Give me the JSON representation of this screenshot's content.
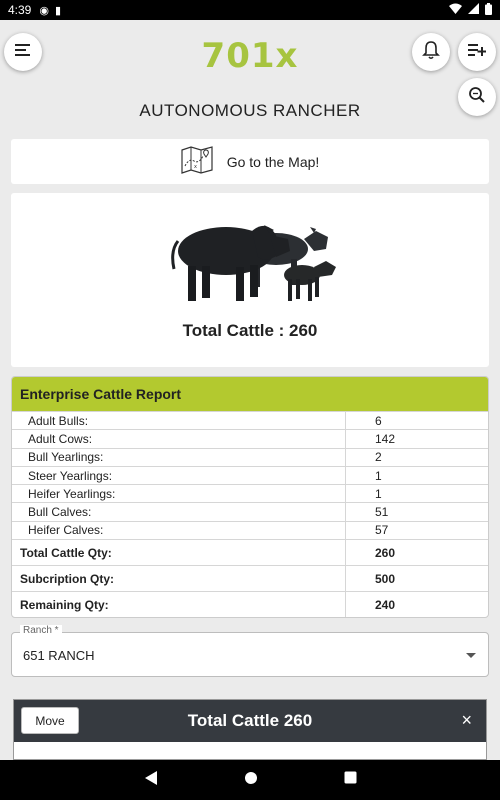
{
  "status_bar": {
    "time": "4:39"
  },
  "header": {
    "logo": "701x",
    "title": "AUTONOMOUS RANCHER"
  },
  "map_button": {
    "label": "Go to the Map!"
  },
  "summary": {
    "total_cattle_label": "Total Cattle : 260"
  },
  "report": {
    "title": "Enterprise Cattle Report",
    "rows": [
      {
        "label": "Adult Bulls:",
        "value": "6"
      },
      {
        "label": "Adult Cows:",
        "value": "142"
      },
      {
        "label": "Bull Yearlings:",
        "value": "2"
      },
      {
        "label": "Steer Yearlings:",
        "value": "1"
      },
      {
        "label": "Heifer Yearlings:",
        "value": "1"
      },
      {
        "label": "Bull Calves:",
        "value": "51"
      },
      {
        "label": "Heifer Calves:",
        "value": "57"
      }
    ],
    "totals": [
      {
        "label": "Total Cattle Qty:",
        "value": "260"
      },
      {
        "label": "Subcription Qty:",
        "value": "500"
      },
      {
        "label": "Remaining Qty:",
        "value": "240"
      }
    ]
  },
  "ranch_select": {
    "label": "Ranch *",
    "value": "651 RANCH"
  },
  "bottom_sheet": {
    "move_label": "Move",
    "title": "Total Cattle 260",
    "close": "×"
  },
  "icons": {
    "menu": "menu-icon",
    "bell": "bell-icon",
    "add_list": "playlist-add-icon",
    "search": "zoom-search-icon",
    "map": "folded-map-icon",
    "cattle": "cattle-illustration"
  },
  "colors": {
    "brand_green": "#a7c440",
    "report_header": "#b3c92f",
    "sheet_bar": "#363a40"
  }
}
